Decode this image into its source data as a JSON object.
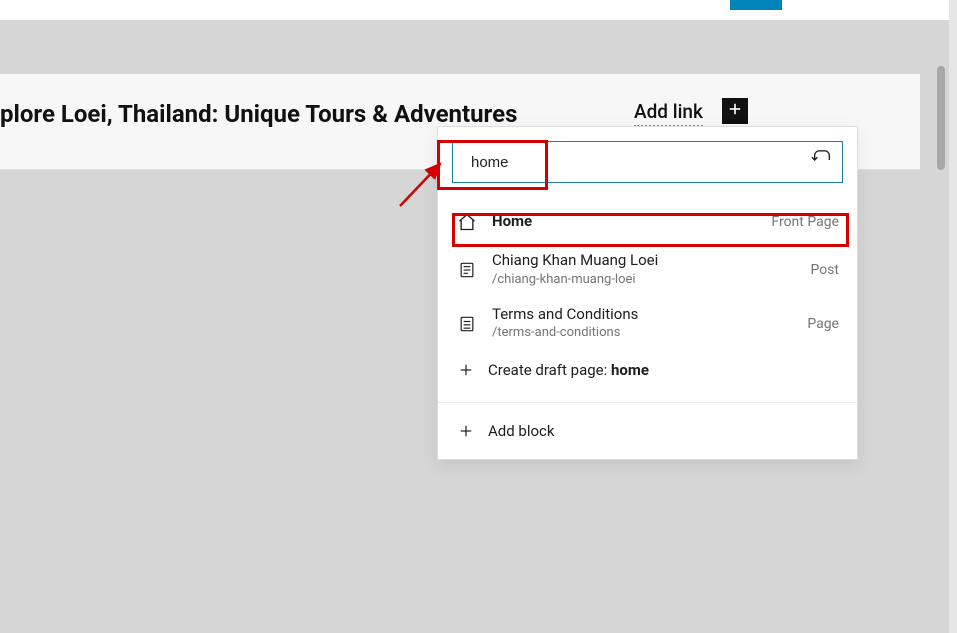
{
  "header": {
    "page_heading": "plore Loei, Thailand: Unique Tours & Adventures",
    "add_link_label": "Add link"
  },
  "search": {
    "value": "home"
  },
  "results": [
    {
      "icon": "home-icon",
      "title": "Home",
      "slug": "",
      "type": "Front Page",
      "bold": true
    },
    {
      "icon": "post-icon",
      "title": "Chiang Khan Muang Loei",
      "slug": "/chiang-khan-muang-loei",
      "type": "Post",
      "bold": false
    },
    {
      "icon": "page-icon",
      "title": "Terms and Conditions",
      "slug": "/terms-and-conditions",
      "type": "Page",
      "bold": false
    }
  ],
  "create_draft": {
    "prefix": "Create draft page: ",
    "term": "home"
  },
  "add_block": {
    "label": "Add block"
  }
}
